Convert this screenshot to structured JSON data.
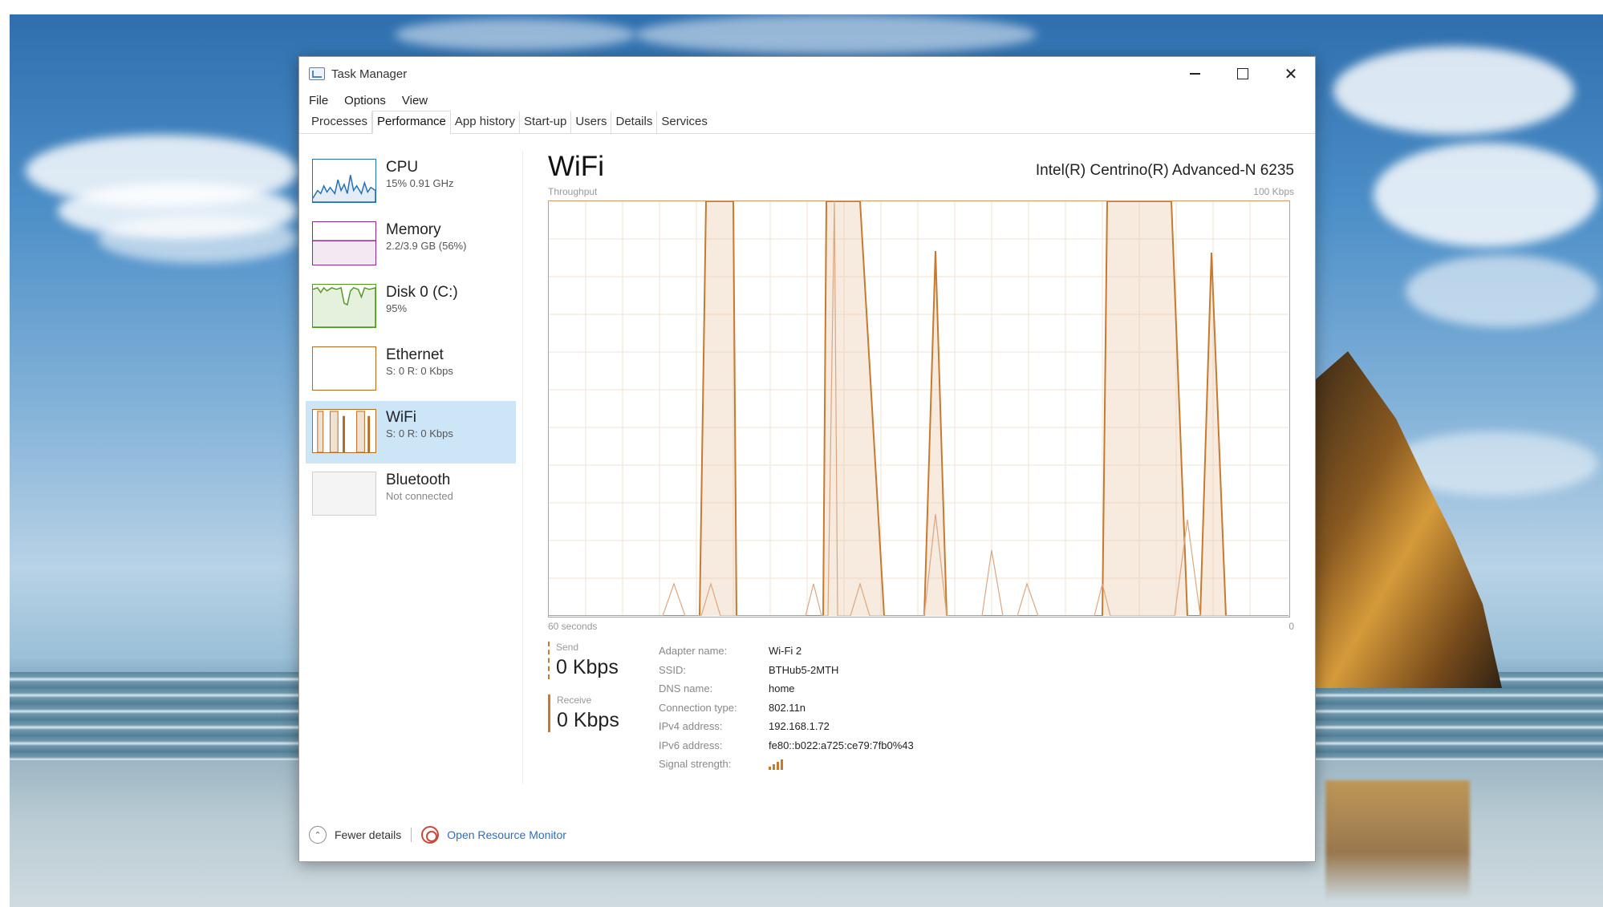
{
  "window": {
    "title": "Task Manager"
  },
  "menu": [
    "File",
    "Options",
    "View"
  ],
  "tabs": [
    "Processes",
    "Performance",
    "App history",
    "Start-up",
    "Users",
    "Details",
    "Services"
  ],
  "active_tab": "Performance",
  "sidebar": {
    "items": [
      {
        "name": "CPU",
        "sub": "15% 0.91 GHz",
        "icon": "cpu-graph-icon",
        "color": "#1f6fb5"
      },
      {
        "name": "Memory",
        "sub": "2.2/3.9 GB (56%)",
        "icon": "memory-graph-icon",
        "color": "#8b2a8c"
      },
      {
        "name": "Disk 0 (C:)",
        "sub": "95%",
        "icon": "disk-graph-icon",
        "color": "#4f9a1e"
      },
      {
        "name": "Ethernet",
        "sub": "S: 0 R: 0 Kbps",
        "icon": "ethernet-graph-icon",
        "color": "#b56a1e"
      },
      {
        "name": "WiFi",
        "sub": "S: 0 R: 0 Kbps",
        "icon": "wifi-graph-icon",
        "color": "#b56a1e",
        "selected": true
      },
      {
        "name": "Bluetooth",
        "sub": "Not connected",
        "icon": "bluetooth-graph-icon",
        "color": "#999999"
      }
    ]
  },
  "main": {
    "title": "WiFi",
    "adapter": "Intel(R) Centrino(R) Advanced-N 6235",
    "throughput_label": "Throughput",
    "max_label": "100 Kbps",
    "time_label": "60 seconds",
    "zero_label": "0",
    "accent_color": "#c77a2e"
  },
  "stats": {
    "send_label": "Send",
    "send_value": "0 Kbps",
    "receive_label": "Receive",
    "receive_value": "0 Kbps"
  },
  "details": [
    {
      "label": "Adapter name:",
      "value": "Wi-Fi 2"
    },
    {
      "label": "SSID:",
      "value": "BTHub5-2MTH"
    },
    {
      "label": "DNS name:",
      "value": "home"
    },
    {
      "label": "Connection type:",
      "value": "802.11n"
    },
    {
      "label": "IPv4 address:",
      "value": "192.168.1.72"
    },
    {
      "label": "IPv6 address:",
      "value": "fe80::b022:a725:ce79:7fb0%43"
    },
    {
      "label": "Signal strength:",
      "value": ""
    }
  ],
  "signal_bars": 4,
  "footer": {
    "fewer_details": "Fewer details",
    "open_resource_monitor": "Open Resource Monitor"
  }
}
